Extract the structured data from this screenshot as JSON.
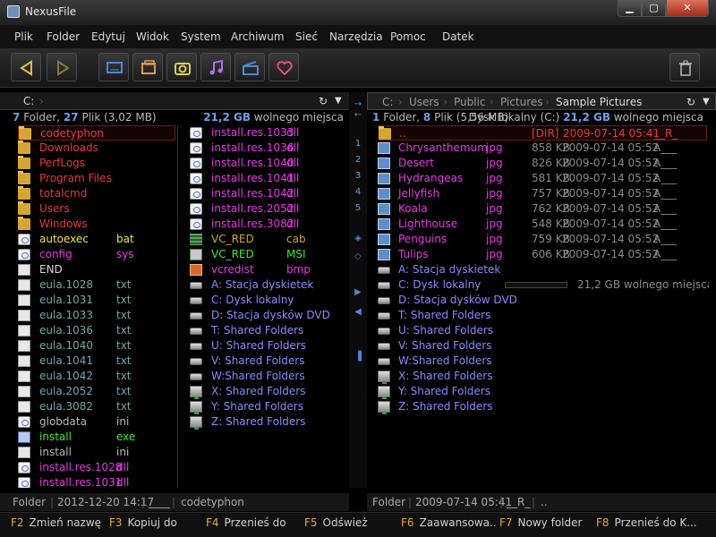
{
  "app": {
    "title": "NexusFile"
  },
  "window_controls": {
    "minimize": "▁",
    "maximize": "▢",
    "close": "✕"
  },
  "menu": [
    "Plik",
    "Folder",
    "Edytuj",
    "Widok",
    "System",
    "Archiwum",
    "Sieć",
    "Narzędzia",
    "Pomoc",
    "Datek"
  ],
  "left_panel": {
    "path": "C:",
    "info": {
      "folders": "7",
      "folder_label": "Folder,",
      "files": "27",
      "files_label": "Plik (3,02 MB)",
      "free": "21,2 GB",
      "free_label": "wolnego miejsca"
    },
    "col1": [
      {
        "name": "codetyphon",
        "ext": "",
        "color": "#e8383d",
        "icon": "folder"
      },
      {
        "name": "Downloads",
        "ext": "",
        "color": "#e8383d",
        "icon": "folder"
      },
      {
        "name": "PerfLogs",
        "ext": "",
        "color": "#e8383d",
        "icon": "folder"
      },
      {
        "name": "Program Files",
        "ext": "",
        "color": "#e8383d",
        "icon": "folder"
      },
      {
        "name": "totalcmd",
        "ext": "",
        "color": "#e8383d",
        "icon": "folder"
      },
      {
        "name": "Users",
        "ext": "",
        "color": "#e8383d",
        "icon": "folder"
      },
      {
        "name": "Windows",
        "ext": "",
        "color": "#e8383d",
        "icon": "folder"
      },
      {
        "name": "autoexec",
        "ext": "bat",
        "color": "#f2e43a",
        "icon": "lib"
      },
      {
        "name": "config",
        "ext": "sys",
        "color": "#e838e8",
        "icon": "lib"
      },
      {
        "name": "END",
        "ext": "",
        "color": "#d8d8d8",
        "icon": "doc"
      },
      {
        "name": "eula.1028",
        "ext": "txt",
        "color": "#6fa8a8",
        "icon": "doc"
      },
      {
        "name": "eula.1031",
        "ext": "txt",
        "color": "#6fa8a8",
        "icon": "doc"
      },
      {
        "name": "eula.1033",
        "ext": "txt",
        "color": "#6fa8a8",
        "icon": "doc"
      },
      {
        "name": "eula.1036",
        "ext": "txt",
        "color": "#6fa8a8",
        "icon": "doc"
      },
      {
        "name": "eula.1040",
        "ext": "txt",
        "color": "#6fa8a8",
        "icon": "doc"
      },
      {
        "name": "eula.1041",
        "ext": "txt",
        "color": "#6fa8a8",
        "icon": "doc"
      },
      {
        "name": "eula.1042",
        "ext": "txt",
        "color": "#6fa8a8",
        "icon": "doc"
      },
      {
        "name": "eula.2052",
        "ext": "txt",
        "color": "#6fa8a8",
        "icon": "doc"
      },
      {
        "name": "eula.3082",
        "ext": "txt",
        "color": "#6fa8a8",
        "icon": "doc"
      },
      {
        "name": "globdata",
        "ext": "ini",
        "color": "#b8b8b8",
        "icon": "lib"
      },
      {
        "name": "install",
        "ext": "exe",
        "color": "#38e838",
        "icon": "exe"
      },
      {
        "name": "install",
        "ext": "ini",
        "color": "#b8b8b8",
        "icon": "doc"
      },
      {
        "name": "install.res.1028",
        "ext": "dll",
        "color": "#e838e8",
        "icon": "lib"
      },
      {
        "name": "install.res.1031",
        "ext": "dll",
        "color": "#e838e8",
        "icon": "lib"
      }
    ],
    "col2": [
      {
        "name": "install.res.1033",
        "ext": "dll",
        "color": "#e838e8",
        "icon": "lib"
      },
      {
        "name": "install.res.1036",
        "ext": "dll",
        "color": "#e838e8",
        "icon": "lib"
      },
      {
        "name": "install.res.1040",
        "ext": "dll",
        "color": "#e838e8",
        "icon": "lib"
      },
      {
        "name": "install.res.1041",
        "ext": "dll",
        "color": "#e838e8",
        "icon": "lib"
      },
      {
        "name": "install.res.1042",
        "ext": "dll",
        "color": "#e838e8",
        "icon": "lib"
      },
      {
        "name": "install.res.2052",
        "ext": "dll",
        "color": "#e838e8",
        "icon": "lib"
      },
      {
        "name": "install.res.3082",
        "ext": "dll",
        "color": "#e838e8",
        "icon": "lib"
      },
      {
        "name": "VC_RED",
        "ext": "cab",
        "color": "#c8a832",
        "icon": "cab"
      },
      {
        "name": "VC_RED",
        "ext": "MSI",
        "color": "#38e838",
        "icon": "msi"
      },
      {
        "name": "vcredist",
        "ext": "bmp",
        "color": "#e838e8",
        "icon": "bmp"
      },
      {
        "name": "A: Stacja dyskietek",
        "ext": "",
        "color": "#8888ff",
        "icon": "drv"
      },
      {
        "name": "C: Dysk lokalny",
        "ext": "",
        "color": "#8888ff",
        "icon": "drv"
      },
      {
        "name": "D: Stacja dysków DVD",
        "ext": "",
        "color": "#8888ff",
        "icon": "drv"
      },
      {
        "name": "T: Shared Folders",
        "ext": "",
        "color": "#8888ff",
        "icon": "drv"
      },
      {
        "name": "U: Shared Folders",
        "ext": "",
        "color": "#8888ff",
        "icon": "drv"
      },
      {
        "name": "V: Shared Folders",
        "ext": "",
        "color": "#8888ff",
        "icon": "drv"
      },
      {
        "name": "W:Shared Folders",
        "ext": "",
        "color": "#8888ff",
        "icon": "drv"
      },
      {
        "name": "X: Shared Folders",
        "ext": "",
        "color": "#8888ff",
        "icon": "net"
      },
      {
        "name": "Y: Shared Folders",
        "ext": "",
        "color": "#8888ff",
        "icon": "net"
      },
      {
        "name": "Z: Shared Folders",
        "ext": "",
        "color": "#8888ff",
        "icon": "net"
      }
    ],
    "status": {
      "type": "Folder",
      "date": "2012-12-20 14:17",
      "attr": "____",
      "name": "codetyphon"
    }
  },
  "divider_buttons": [
    "→",
    "←",
    "1",
    "2",
    "3",
    "4",
    "5",
    "◈",
    "◇",
    "▶",
    "◀",
    "▐"
  ],
  "right_panel": {
    "path_segments": [
      "C:",
      "Users",
      "Public",
      "Pictures",
      "Sample Pictures"
    ],
    "info": {
      "folders": "1",
      "folder_label": "Folder,",
      "files": "8",
      "files_label": "Plik (5,56 MB)",
      "drive": "Dysk lokalny (C:)",
      "free": "21,2 GB",
      "free_label": "wolnego miejsca"
    },
    "files": [
      {
        "name": "..",
        "ext": "",
        "size": "[DIR]",
        "date": "2009-07-14 05:41",
        "attr": "__R_",
        "color": "#e8383d",
        "icon": "folder"
      },
      {
        "name": "Chrysanthemum",
        "ext": "jpg",
        "size": "858 KB",
        "date": "2009-07-14 05:52",
        "attr": "A___",
        "color": "#e838e8",
        "icon": "img"
      },
      {
        "name": "Desert",
        "ext": "jpg",
        "size": "826 KB",
        "date": "2009-07-14 05:52",
        "attr": "A___",
        "color": "#e838e8",
        "icon": "img"
      },
      {
        "name": "Hydrangeas",
        "ext": "jpg",
        "size": "581 KB",
        "date": "2009-07-14 05:52",
        "attr": "A___",
        "color": "#e838e8",
        "icon": "img"
      },
      {
        "name": "Jellyfish",
        "ext": "jpg",
        "size": "757 KB",
        "date": "2009-07-14 05:52",
        "attr": "A___",
        "color": "#e838e8",
        "icon": "img"
      },
      {
        "name": "Koala",
        "ext": "jpg",
        "size": "762 KB",
        "date": "2009-07-14 05:52",
        "attr": "A___",
        "color": "#e838e8",
        "icon": "img"
      },
      {
        "name": "Lighthouse",
        "ext": "jpg",
        "size": "548 KB",
        "date": "2009-07-14 05:52",
        "attr": "A___",
        "color": "#e838e8",
        "icon": "img"
      },
      {
        "name": "Penguins",
        "ext": "jpg",
        "size": "759 KB",
        "date": "2009-07-14 05:52",
        "attr": "A___",
        "color": "#e838e8",
        "icon": "img"
      },
      {
        "name": "Tulips",
        "ext": "jpg",
        "size": "606 KB",
        "date": "2009-07-14 05:52",
        "attr": "A___",
        "color": "#e838e8",
        "icon": "img"
      }
    ],
    "drives": [
      {
        "name": "A: Stacja dyskietek",
        "icon": "drv"
      },
      {
        "name": "C: Dysk lokalny",
        "icon": "drv"
      },
      {
        "name": "D: Stacja dysków DVD",
        "icon": "drv"
      },
      {
        "name": "T: Shared Folders",
        "icon": "drv"
      },
      {
        "name": "U: Shared Folders",
        "icon": "drv"
      },
      {
        "name": "V: Shared Folders",
        "icon": "drv"
      },
      {
        "name": "W:Shared Folders",
        "icon": "drv"
      },
      {
        "name": "X: Shared Folders",
        "icon": "net"
      },
      {
        "name": "Y: Shared Folders",
        "icon": "net"
      },
      {
        "name": "Z: Shared Folders",
        "icon": "net"
      }
    ],
    "drive_free": "21,2 GB wolnego miejsca",
    "drive_usage": 0.0,
    "status": {
      "type": "Folder",
      "date": "2009-07-14 05:41",
      "attr": "__R_",
      "name": ".."
    }
  },
  "fkeys": [
    {
      "key": "F2",
      "label": "Zmień nazwę"
    },
    {
      "key": "F3",
      "label": "Kopiuj do"
    },
    {
      "key": "F4",
      "label": "Przenieś do"
    },
    {
      "key": "F5",
      "label": "Odśwież"
    },
    {
      "key": "F6",
      "label": "Zaawansowa..."
    },
    {
      "key": "F7",
      "label": "Nowy folder"
    },
    {
      "key": "F8",
      "label": "Przenieś do K..."
    }
  ],
  "colors": {
    "accent": "#4f86d6",
    "folder": "#e8383d",
    "lib": "#e838e8",
    "drive": "#8888ff",
    "ext": "#f2e43a"
  }
}
